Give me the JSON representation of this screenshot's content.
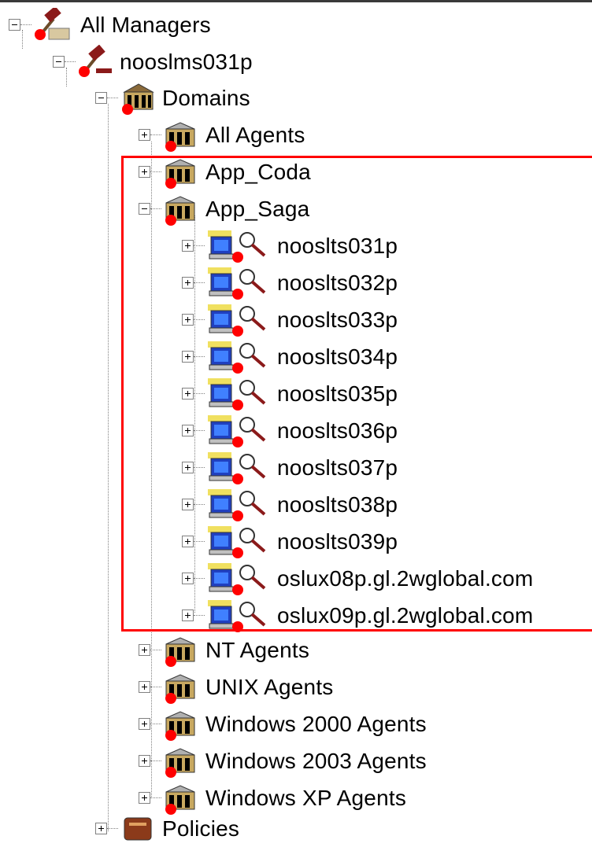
{
  "colors": {
    "highlight": "#ff0000",
    "expander_border": "#808080",
    "status_dot": "#ff0000"
  },
  "tree": {
    "root": {
      "label": "All Managers",
      "icon": "manager-icon",
      "expanded": true
    },
    "manager": {
      "label": "nooslms031p",
      "icon": "manager-icon",
      "expanded": true
    },
    "domains": {
      "label": "Domains",
      "icon": "domain-folder-icon",
      "expanded": true
    },
    "domain_items": [
      {
        "label": "All Agents",
        "icon": "domain-icon",
        "expanded": false
      },
      {
        "label": "App_Coda",
        "icon": "domain-icon",
        "expanded": false
      },
      {
        "label": "App_Saga",
        "icon": "domain-icon",
        "expanded": true
      }
    ],
    "agents": [
      {
        "label": "nooslts031p",
        "icon": "agent-computer-icon"
      },
      {
        "label": "nooslts032p",
        "icon": "agent-computer-icon"
      },
      {
        "label": "nooslts033p",
        "icon": "agent-computer-icon"
      },
      {
        "label": "nooslts034p",
        "icon": "agent-computer-icon"
      },
      {
        "label": "nooslts035p",
        "icon": "agent-computer-icon"
      },
      {
        "label": "nooslts036p",
        "icon": "agent-computer-icon"
      },
      {
        "label": "nooslts037p",
        "icon": "agent-computer-icon"
      },
      {
        "label": "nooslts038p",
        "icon": "agent-computer-icon"
      },
      {
        "label": "nooslts039p",
        "icon": "agent-computer-icon"
      },
      {
        "label": "oslux08p.gl.2wglobal.com",
        "icon": "agent-computer-icon"
      },
      {
        "label": "oslux09p.gl.2wglobal.com",
        "icon": "agent-computer-icon"
      }
    ],
    "other_domains": [
      {
        "label": "NT Agents",
        "icon": "domain-icon"
      },
      {
        "label": "UNIX Agents",
        "icon": "domain-icon"
      },
      {
        "label": "Windows 2000 Agents",
        "icon": "domain-icon"
      },
      {
        "label": "Windows 2003 Agents",
        "icon": "domain-icon"
      },
      {
        "label": "Windows XP Agents",
        "icon": "domain-icon"
      }
    ],
    "policies": {
      "label": "Policies",
      "icon": "policies-icon"
    }
  }
}
